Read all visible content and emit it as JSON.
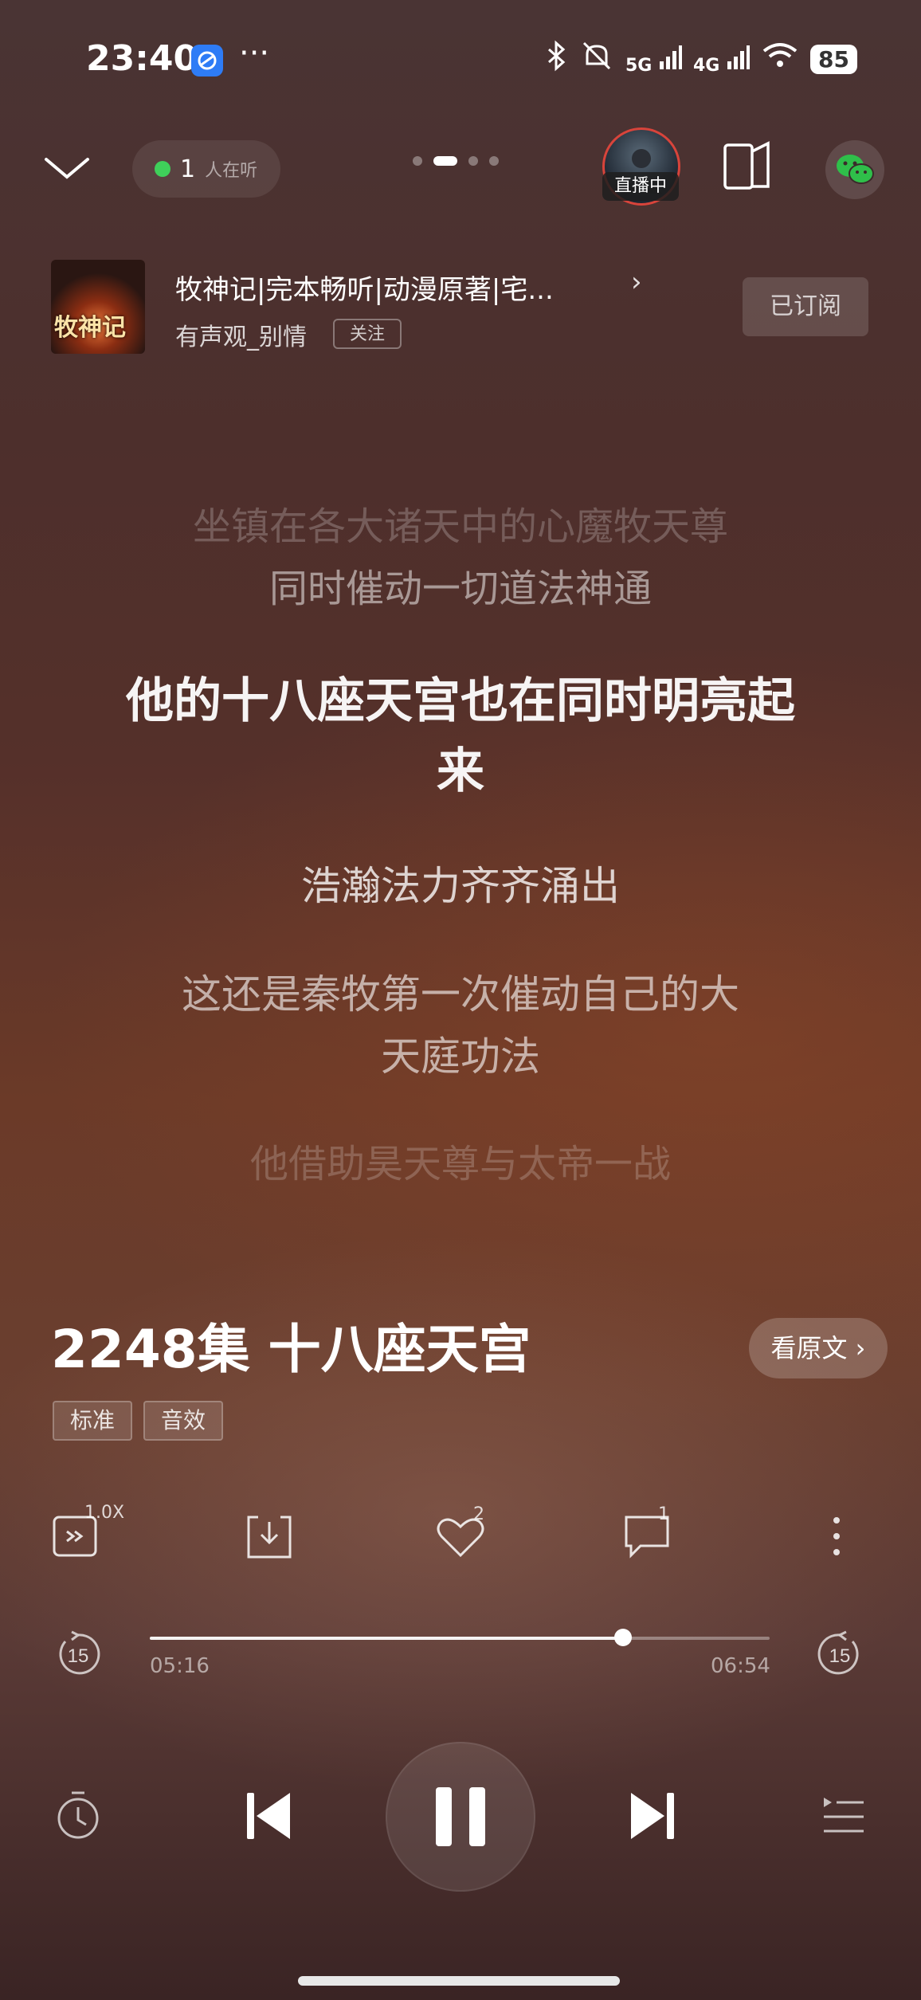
{
  "status_bar": {
    "time": "23:40",
    "more": "···",
    "signal_5g": "5G",
    "signal_4g": "4G",
    "battery": "85",
    "icons": [
      "app-browser-icon",
      "bluetooth-icon",
      "mute-icon",
      "signal-5g-icon",
      "signal-4g-icon",
      "wifi-icon",
      "battery-icon"
    ]
  },
  "header": {
    "listeners_count": "1",
    "listeners_label": "人在听",
    "live_label": "直播中",
    "pager_total": 4,
    "pager_active": 1
  },
  "album": {
    "cover_text": "牧神记",
    "title": "牧神记|完本畅听|动漫原著|宅...",
    "author": "有声观_别情",
    "follow_label": "关注",
    "subscribed_label": "已订阅"
  },
  "lyrics": {
    "prev2": "坐镇在各大诸天中的心魔牧天尊",
    "prev1": "同时催动一切道法神通",
    "current_line1": "他的十八座天宫也在同时明亮起",
    "current_line2": "来",
    "next1": "浩瀚法力齐齐涌出",
    "next2_line1": "这还是秦牧第一次催动自己的大",
    "next2_line2": "天庭功法",
    "next3": "他借助昊天尊与太帝一战"
  },
  "episode": {
    "title": "2248集 十八座天宫",
    "view_original": "看原文 ›",
    "tags": [
      "标准",
      "音效"
    ]
  },
  "controls": {
    "speed": "1.0X",
    "likes": "2",
    "comments": "1"
  },
  "progress": {
    "elapsed": "05:16",
    "total": "06:54",
    "fraction": 0.763,
    "skip_back": "15",
    "skip_forward": "15"
  },
  "colors": {
    "live_ring": "#d8443b",
    "online_dot": "#3fcf5a",
    "app_icon": "#2e7cf6"
  }
}
